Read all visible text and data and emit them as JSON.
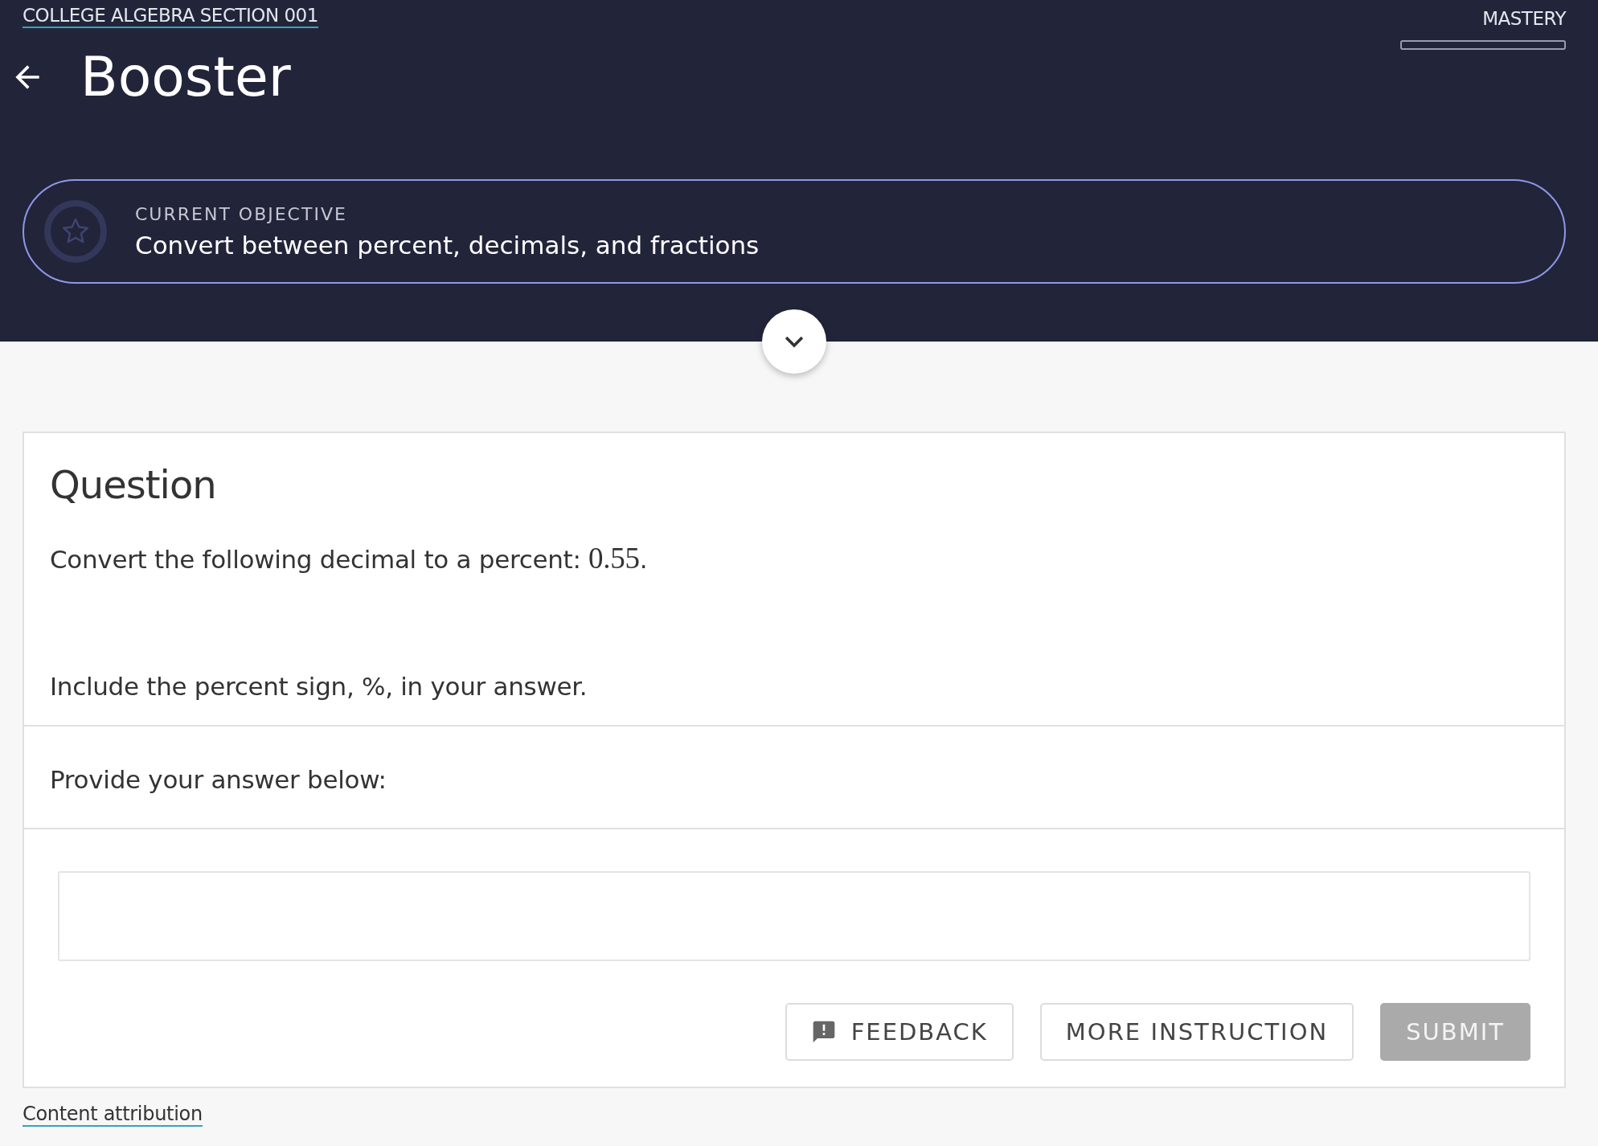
{
  "header": {
    "course_link": "COLLEGE ALGEBRA SECTION 001",
    "title": "Booster",
    "mastery": {
      "label": "MASTERY",
      "level": 0
    }
  },
  "objective": {
    "label": "CURRENT OBJECTIVE",
    "text": "Convert between percent, decimals, and fractions",
    "expanded": false
  },
  "question": {
    "heading": "Question",
    "prompt": [
      {
        "kind": "text",
        "text": "Convert the following decimal to a percent: "
      },
      {
        "kind": "math",
        "text": "0.55"
      },
      {
        "kind": "text",
        "text": "."
      }
    ],
    "instruction": "Include the percent sign, %, in your answer."
  },
  "answer": {
    "label": "Provide your answer below:"
  },
  "buttons": [
    {
      "kind": "feedback",
      "label": "FEEDBACK",
      "disabled": false
    },
    {
      "kind": "plain",
      "label": "MORE INSTRUCTION",
      "disabled": false
    },
    {
      "kind": "primary",
      "label": "SUBMIT",
      "disabled": true
    }
  ],
  "footer": {
    "attribution": "Content attribution"
  }
}
